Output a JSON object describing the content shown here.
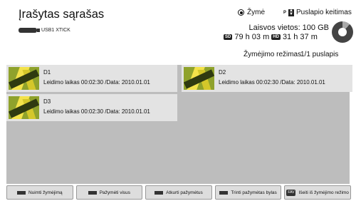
{
  "header": {
    "title": "Įrašytas sąrašas",
    "device": "USB1 XTICK",
    "mode_label": "Žymė",
    "page_key": "P",
    "page_label": "Puslapio keitimas",
    "free_space": "Laisvos vietos: 100 GB",
    "sd_badge": "SD",
    "sd_time": "79 h 03 m",
    "hd_badge": "HD",
    "hd_time": "31 h 37 m",
    "selection_mode": "Žymėjimo režimas",
    "page_info": "1/1 puslapis"
  },
  "recordings": [
    {
      "name": "D1",
      "info": "Leidimo laikas 00:02:30 /Data: 2010.01.01"
    },
    {
      "name": "D2",
      "info": "Leidimo laikas 00:02:30 /Data: 2010.01.01"
    },
    {
      "name": "D3",
      "info": "Leidimo laikas 00:02:30 /Data: 2010.01.01"
    }
  ],
  "buttons": [
    {
      "label": "Nuimti žymėjimą"
    },
    {
      "label": "Pažymėti visus"
    },
    {
      "label": "Atkurti pažymėtus"
    },
    {
      "label": "Trinti pažymėtas bylas"
    },
    {
      "badge": "FAV",
      "label": "Išeiti iš žymėjimo režimo"
    }
  ]
}
